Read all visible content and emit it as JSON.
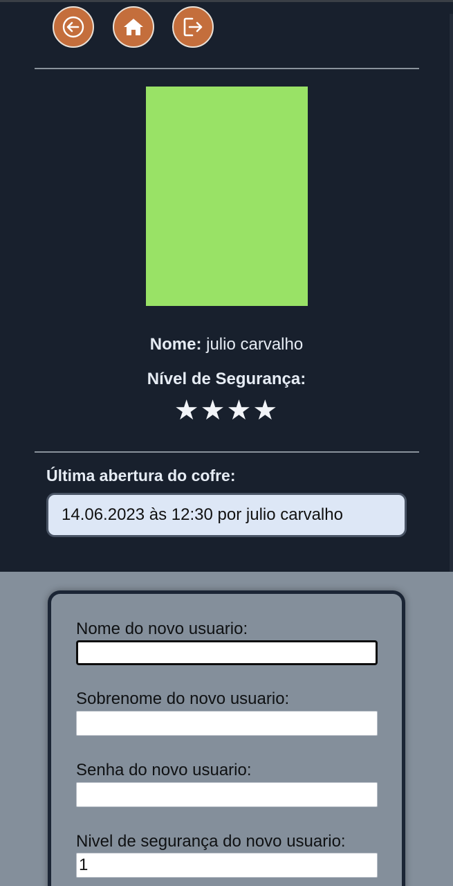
{
  "colors": {
    "top_panel_bg": "#18202d",
    "page_bg": "#848f9b",
    "nav_button": "#c46e3c",
    "photo": "#99e266",
    "text_light": "#e6ecf4",
    "info_box_bg": "#dde7f6"
  },
  "nav": {
    "back_icon": "arrow-left-icon",
    "home_icon": "home-icon",
    "logout_icon": "logout-icon"
  },
  "profile": {
    "photo_color": "#99e266",
    "name_label": "Nome:",
    "name_value": "julio carvalho",
    "security_label": "Nível de Segurança:",
    "stars_text": "★★★★",
    "security_level": 4
  },
  "last_open": {
    "title": "Última abertura do cofre:",
    "value": "14.06.2023 às 12:30 por julio carvalho"
  },
  "form": {
    "nome_label": "Nome do novo usuario:",
    "nome_value": "",
    "sobrenome_label": "Sobrenome do novo usuario:",
    "sobrenome_value": "",
    "senha_label": "Senha do novo usuario:",
    "senha_value": "",
    "nivel_label": "Nivel de segurança do novo usuario:",
    "nivel_value": "1"
  }
}
